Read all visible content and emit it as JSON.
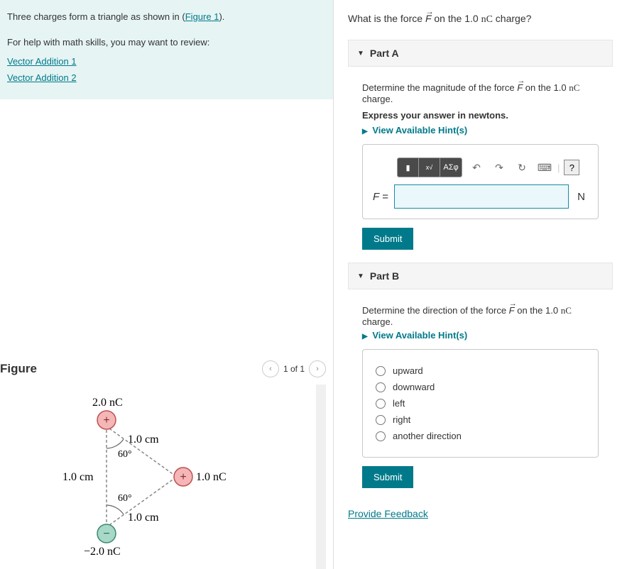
{
  "info": {
    "intro_pre": "Three charges form a triangle as shown in (",
    "figure_link": "Figure 1",
    "intro_post": ").",
    "help_text": "For help with math skills, you may want to review:",
    "link1": "Vector Addition 1",
    "link2": "Vector Addition 2"
  },
  "figure": {
    "title": "Figure",
    "page_label": "1 of 1",
    "labels": {
      "top_charge": "2.0 nC",
      "right_charge": "1.0 nC",
      "bottom_charge": "−2.0 nC",
      "left_dist": "1.0 cm",
      "upper_diag": "1.0 cm",
      "lower_diag": "1.0 cm",
      "angle_top": "60°",
      "angle_bot": "60°",
      "plus": "+",
      "minus": "−"
    }
  },
  "question": {
    "prefix": "What is the force ",
    "vec": "F",
    "mid": " on the 1.0 ",
    "unit": "nC",
    "suffix": " charge?"
  },
  "partA": {
    "header": "Part A",
    "instr_pre": "Determine the magnitude of the force ",
    "instr_vec": "F",
    "instr_mid": " on the 1.0 ",
    "instr_unit": "nC",
    "instr_post": " charge.",
    "express": "Express your answer in newtons.",
    "hints": "View Available Hint(s)",
    "var_label": "F =",
    "unit_label": "N",
    "submit": "Submit",
    "tool_greek": "ΑΣφ"
  },
  "partB": {
    "header": "Part B",
    "instr_pre": "Determine the direction of the force ",
    "instr_vec": "F",
    "instr_mid": " on the 1.0 ",
    "instr_unit": "nC",
    "instr_post": " charge.",
    "hints": "View Available Hint(s)",
    "options": [
      "upward",
      "downward",
      "left",
      "right",
      "another direction"
    ],
    "submit": "Submit"
  },
  "feedback": "Provide Feedback"
}
